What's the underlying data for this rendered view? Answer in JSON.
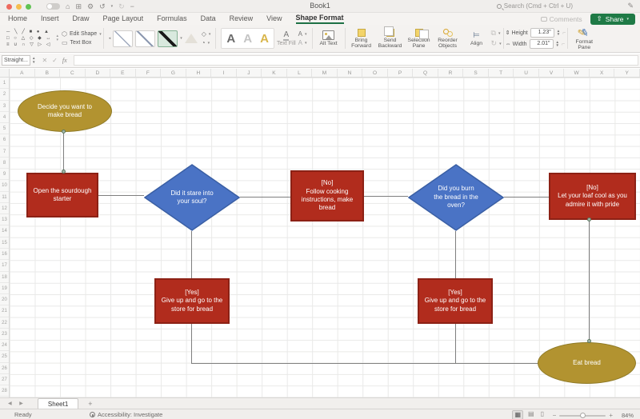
{
  "titlebar": {
    "title": "Book1",
    "search_placeholder": "Search (Cmd + Ctrl + U)"
  },
  "tabs": [
    "Home",
    "Insert",
    "Draw",
    "Page Layout",
    "Formulas",
    "Data",
    "Review",
    "View",
    "Shape Format"
  ],
  "topright": {
    "comments": "Comments",
    "share": "Share"
  },
  "ribbon": {
    "edit_shape": "Edit Shape",
    "text_box": "Text Box",
    "text_fill": "Text Fill",
    "alt_text": "Alt Text",
    "bring_forward": "Bring Forward",
    "send_backward": "Send Backward",
    "selection_pane": "Selection Pane",
    "reorder_objects": "Reorder Objects",
    "align": "Align",
    "height_label": "Height",
    "height_value": "1.23\"",
    "width_label": "Width",
    "width_value": "2.01\"",
    "format_pane": "Format Pane"
  },
  "formula_bar": {
    "name_box": "Straight...",
    "fx": "fx"
  },
  "grid": {
    "columns": [
      "A",
      "B",
      "C",
      "D",
      "E",
      "F",
      "G",
      "H",
      "I",
      "J",
      "K",
      "L",
      "M",
      "N",
      "O",
      "P",
      "Q",
      "R",
      "S",
      "T",
      "U",
      "V",
      "W",
      "X",
      "Y"
    ],
    "rows": [
      "1",
      "2",
      "3",
      "4",
      "5",
      "6",
      "7",
      "8",
      "9",
      "10",
      "11",
      "12",
      "13",
      "14",
      "15",
      "16",
      "17",
      "18",
      "19",
      "20",
      "21",
      "22",
      "23",
      "24",
      "25",
      "26",
      "27",
      "28"
    ]
  },
  "flowchart": {
    "start": "Decide you want to make bread",
    "open_starter": "Open the sourdough starter",
    "stare_q": "Did it stare into your soul?",
    "no_follow": "[No]\nFollow cooking instructions, make bread",
    "burn_q": "Did you burn the bread in the oven?",
    "no_cool": "[No]\nLet your loaf cool as you admire it with pride",
    "yes_store_1": "[Yes]\nGive up and go to the store for bread",
    "yes_store_2": "[Yes]\nGive up and go to the store for bread",
    "end": "Eat bread"
  },
  "colors": {
    "excel_green": "#1f7a46",
    "shape_gold": "#b29330",
    "shape_red": "#b12c1d",
    "shape_blue": "#4a73c5",
    "connector_gray": "#7f7f7f"
  },
  "sheet_bar": {
    "tab": "Sheet1",
    "add": "+"
  },
  "status_bar": {
    "ready": "Ready",
    "accessibility": "Accessibility: Investigate",
    "zoom": "84%"
  }
}
